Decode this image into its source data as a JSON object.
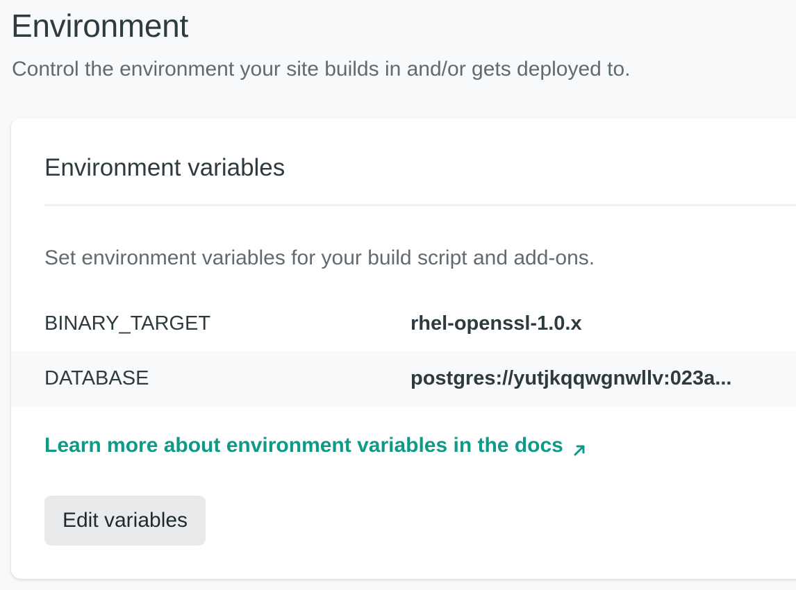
{
  "page": {
    "title": "Environment",
    "subtitle": "Control the environment your site builds in and/or gets deployed to."
  },
  "card": {
    "title": "Environment variables",
    "description": "Set environment variables for your build script and add-ons.",
    "variables": [
      {
        "key": "BINARY_TARGET",
        "value": "rhel-openssl-1.0.x"
      },
      {
        "key": "DATABASE",
        "value": "postgres://yutjkqqwgnwllv:023a..."
      }
    ],
    "docs_link": {
      "label": "Learn more about environment variables in the docs",
      "icon": "external-arrow-icon"
    },
    "edit_button": "Edit variables"
  },
  "colors": {
    "background": "#f7f9fa",
    "card": "#ffffff",
    "text": "#2d3b41",
    "muted_text": "#5f6b70",
    "link": "#0e9a86",
    "button_bg": "#e8eaeb",
    "row_alt": "#f7f9fa"
  }
}
